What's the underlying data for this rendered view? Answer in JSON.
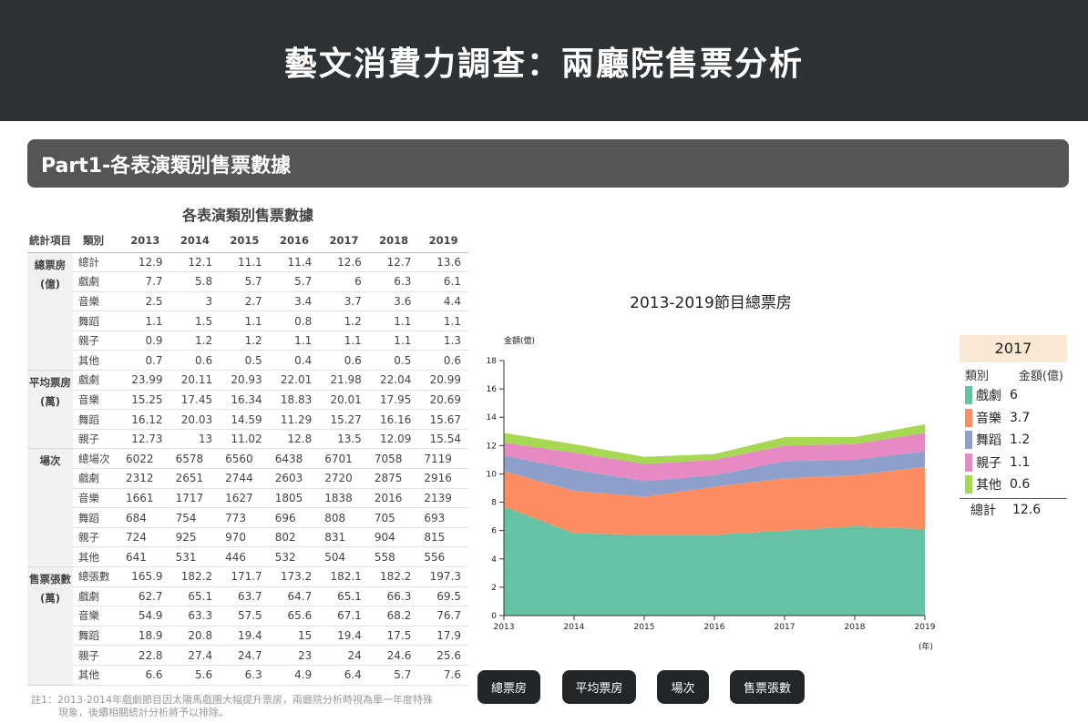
{
  "header": {
    "title": "藝文消費力調查：兩廳院售票分析"
  },
  "section": {
    "title": "Part1-各表演類別售票數據"
  },
  "table": {
    "title": "各表演類別售票數據",
    "col_stat": "統計項目",
    "col_cat": "類別",
    "years": [
      "2013",
      "2014",
      "2015",
      "2016",
      "2017",
      "2018",
      "2019"
    ],
    "groups": [
      {
        "label": "總票房\n(億)",
        "rows": [
          {
            "cat": "總計",
            "vals": [
              "12.9",
              "12.1",
              "11.1",
              "11.4",
              "12.6",
              "12.7",
              "13.6"
            ]
          },
          {
            "cat": "戲劇",
            "vals": [
              "7.7",
              "5.8",
              "5.7",
              "5.7",
              "6",
              "6.3",
              "6.1"
            ]
          },
          {
            "cat": "音樂",
            "vals": [
              "2.5",
              "3",
              "2.7",
              "3.4",
              "3.7",
              "3.6",
              "4.4"
            ]
          },
          {
            "cat": "舞蹈",
            "vals": [
              "1.1",
              "1.5",
              "1.1",
              "0.8",
              "1.2",
              "1.1",
              "1.1"
            ]
          },
          {
            "cat": "親子",
            "vals": [
              "0.9",
              "1.2",
              "1.2",
              "1.1",
              "1.1",
              "1.1",
              "1.3"
            ]
          },
          {
            "cat": "其他",
            "vals": [
              "0.7",
              "0.6",
              "0.5",
              "0.4",
              "0.6",
              "0.5",
              "0.6"
            ]
          }
        ]
      },
      {
        "label": "平均票房\n(萬)",
        "rows": [
          {
            "cat": "戲劇",
            "vals": [
              "23.99",
              "20.11",
              "20.93",
              "22.01",
              "21.98",
              "22.04",
              "20.99"
            ]
          },
          {
            "cat": "音樂",
            "vals": [
              "15.25",
              "17.45",
              "16.34",
              "18.83",
              "20.01",
              "17.95",
              "20.69"
            ]
          },
          {
            "cat": "舞蹈",
            "vals": [
              "16.12",
              "20.03",
              "14.59",
              "11.29",
              "15.27",
              "16.16",
              "15.67"
            ]
          },
          {
            "cat": "親子",
            "vals": [
              "12.73",
              "13",
              "11.02",
              "12.8",
              "13.5",
              "12.09",
              "15.54"
            ]
          }
        ]
      },
      {
        "label": "場次",
        "rows": [
          {
            "cat": "總場次",
            "vals": [
              "6022",
              "6578",
              "6560",
              "6438",
              "6701",
              "7058",
              "7119"
            ]
          },
          {
            "cat": "戲劇",
            "vals": [
              "2312",
              "2651",
              "2744",
              "2603",
              "2720",
              "2875",
              "2916"
            ]
          },
          {
            "cat": "音樂",
            "vals": [
              "1661",
              "1717",
              "1627",
              "1805",
              "1838",
              "2016",
              "2139"
            ]
          },
          {
            "cat": "舞蹈",
            "vals": [
              "684",
              "754",
              "773",
              "696",
              "808",
              "705",
              "693"
            ]
          },
          {
            "cat": "親子",
            "vals": [
              "724",
              "925",
              "970",
              "802",
              "831",
              "904",
              "815"
            ]
          },
          {
            "cat": "其他",
            "vals": [
              "641",
              "531",
              "446",
              "532",
              "504",
              "558",
              "556"
            ]
          }
        ]
      },
      {
        "label": "售票張數\n(萬)",
        "rows": [
          {
            "cat": "總張數",
            "vals": [
              "165.9",
              "182.2",
              "171.7",
              "173.2",
              "182.1",
              "182.2",
              "197.3"
            ]
          },
          {
            "cat": "戲劇",
            "vals": [
              "62.7",
              "65.1",
              "63.7",
              "64.7",
              "65.1",
              "66.3",
              "69.5"
            ]
          },
          {
            "cat": "音樂",
            "vals": [
              "54.9",
              "63.3",
              "57.5",
              "65.6",
              "67.1",
              "68.2",
              "76.7"
            ]
          },
          {
            "cat": "舞蹈",
            "vals": [
              "18.9",
              "20.8",
              "19.4",
              "15",
              "19.4",
              "17.5",
              "17.9"
            ]
          },
          {
            "cat": "親子",
            "vals": [
              "22.8",
              "27.4",
              "24.7",
              "23",
              "24",
              "24.6",
              "25.6"
            ]
          },
          {
            "cat": "其他",
            "vals": [
              "6.6",
              "5.6",
              "6.3",
              "4.9",
              "6.4",
              "5.7",
              "7.6"
            ]
          }
        ]
      }
    ]
  },
  "note": {
    "line1": "註1：2013-2014年戲劇節目因太陽馬戲團大幅提升票房，兩廳院分析時視為單一年度特殊",
    "line2": "現象，後續相關統計分析將予以排除。"
  },
  "chart_data": {
    "type": "area",
    "stacked": true,
    "title": "2013-2019節目總票房",
    "ylabel": "金額(億)",
    "xlabel": "(年)",
    "x": [
      2013,
      2014,
      2015,
      2016,
      2017,
      2018,
      2019
    ],
    "ylim": [
      0,
      18
    ],
    "yticks": [
      0,
      2,
      4,
      6,
      8,
      10,
      12,
      14,
      16,
      18
    ],
    "grid": false,
    "series": [
      {
        "name": "戲劇",
        "color": "#66c2a5",
        "values": [
          7.7,
          5.8,
          5.7,
          5.7,
          6,
          6.3,
          6.1
        ]
      },
      {
        "name": "音樂",
        "color": "#fc8d62",
        "values": [
          2.5,
          3,
          2.7,
          3.4,
          3.7,
          3.6,
          4.4
        ]
      },
      {
        "name": "舞蹈",
        "color": "#8da0cb",
        "values": [
          1.1,
          1.5,
          1.1,
          0.8,
          1.2,
          1.1,
          1.1
        ]
      },
      {
        "name": "親子",
        "color": "#e78ac3",
        "values": [
          0.9,
          1.2,
          1.2,
          1.1,
          1.1,
          1.1,
          1.3
        ]
      },
      {
        "name": "其他",
        "color": "#a6d854",
        "values": [
          0.7,
          0.6,
          0.5,
          0.4,
          0.6,
          0.5,
          0.6
        ]
      }
    ]
  },
  "legend": {
    "year": "2017",
    "col_cat": "類別",
    "col_amount": "金額(億)",
    "items": [
      {
        "name": "戲劇",
        "value": "6",
        "color": "#66c2a5"
      },
      {
        "name": "音樂",
        "value": "3.7",
        "color": "#fc8d62"
      },
      {
        "name": "舞蹈",
        "value": "1.2",
        "color": "#8da0cb"
      },
      {
        "name": "親子",
        "value": "1.1",
        "color": "#e78ac3"
      },
      {
        "name": "其他",
        "value": "0.6",
        "color": "#a6d854"
      }
    ],
    "total_label": "總計",
    "total_value": "12.6"
  },
  "buttons": [
    "總票房",
    "平均票房",
    "場次",
    "售票張數"
  ]
}
